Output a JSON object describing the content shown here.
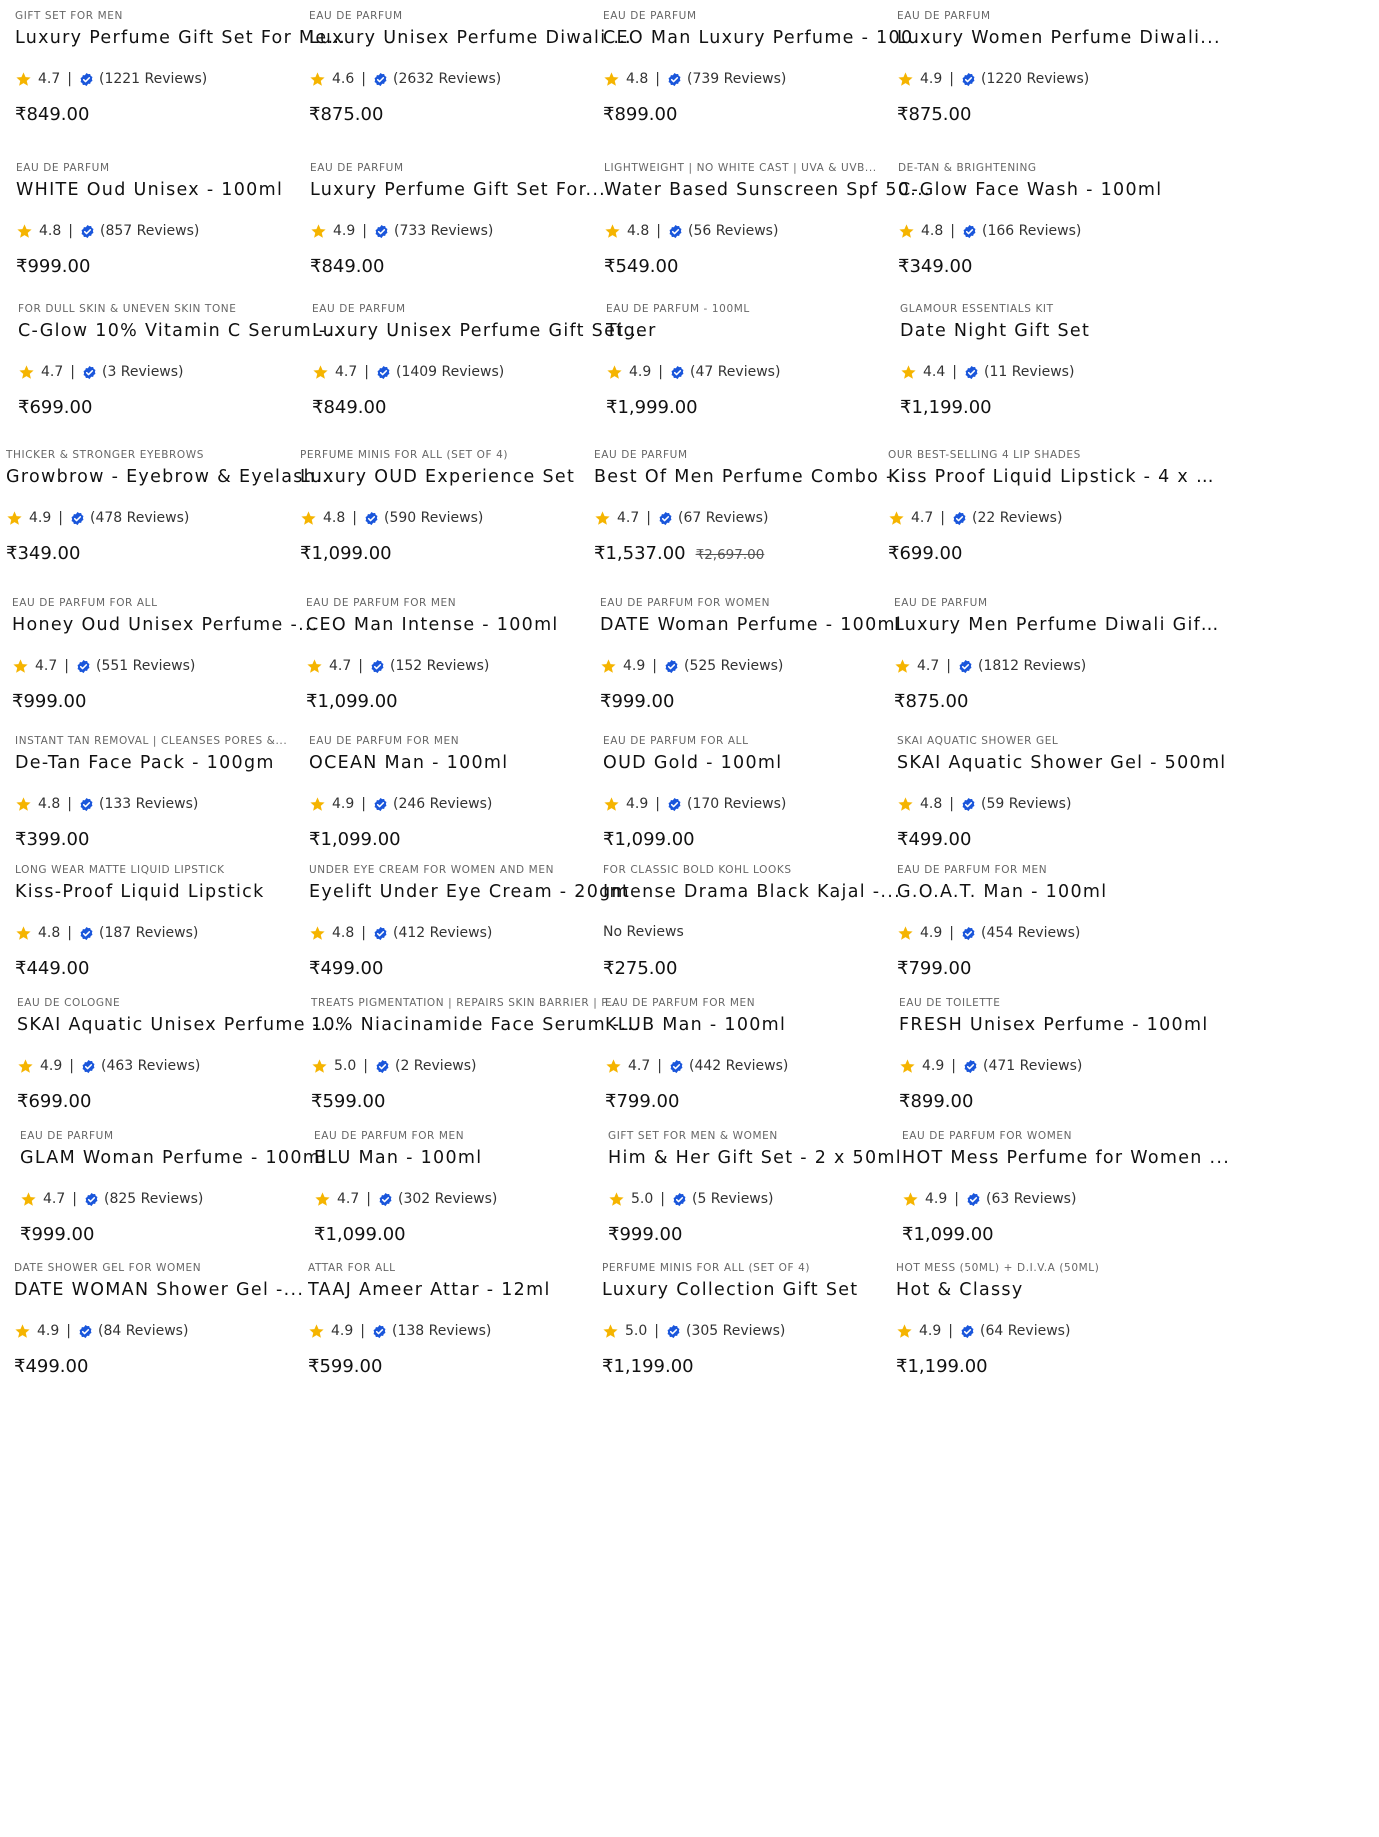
{
  "colors": {
    "star": "#f5b400",
    "verified_badge": "#1a56db",
    "text": "#111111",
    "muted": "#666666"
  },
  "icons": {
    "rating": "star-icon",
    "verified": "verified-badge-icon"
  },
  "products": [
    {
      "category": "Gift Set For Men",
      "title": "Luxury Perfume Gift Set For Me...",
      "rating": "4.7",
      "reviews": "(1221 Reviews)",
      "price": "₹849.00"
    },
    {
      "category": "Eau De Parfum",
      "title": "Luxury Unisex Perfume Diwali G...",
      "rating": "4.6",
      "reviews": "(2632 Reviews)",
      "price": "₹875.00"
    },
    {
      "category": "Eau De Parfum",
      "title": "CEO Man Luxury Perfume - 100ml",
      "rating": "4.8",
      "reviews": "(739 Reviews)",
      "price": "₹899.00"
    },
    {
      "category": "Eau De Parfum",
      "title": "Luxury Women Perfume Diwali...",
      "rating": "4.9",
      "reviews": "(1220 Reviews)",
      "price": "₹875.00"
    },
    {
      "category": "Eau De Parfum",
      "title": "WHITE Oud Unisex - 100ml",
      "rating": "4.8",
      "reviews": "(857 Reviews)",
      "price": "₹999.00"
    },
    {
      "category": "Eau De Parfum",
      "title": "Luxury Perfume Gift Set For...",
      "rating": "4.9",
      "reviews": "(733 Reviews)",
      "price": "₹849.00"
    },
    {
      "category": "Lightweight | No White Cast | UVA & UVB...",
      "title": "Water Based Sunscreen Spf 50...",
      "rating": "4.8",
      "reviews": "(56 Reviews)",
      "price": "₹549.00"
    },
    {
      "category": "De-Tan & Brightening",
      "title": "C-Glow Face Wash - 100ml",
      "rating": "4.8",
      "reviews": "(166 Reviews)",
      "price": "₹349.00"
    },
    {
      "category": "For Dull Skin & Uneven Skin Tone",
      "title": "C-Glow 10% Vitamin C Serum -...",
      "rating": "4.7",
      "reviews": "(3 Reviews)",
      "price": "₹699.00"
    },
    {
      "category": "Eau De Parfum",
      "title": "Luxury Unisex Perfume Gift Set ...",
      "rating": "4.7",
      "reviews": "(1409 Reviews)",
      "price": "₹849.00"
    },
    {
      "category": "Eau De Parfum - 100ml",
      "title": "Tiger",
      "rating": "4.9",
      "reviews": "(47 Reviews)",
      "price": "₹1,999.00"
    },
    {
      "category": "Glamour Essentials Kit",
      "title": "Date Night Gift Set",
      "rating": "4.4",
      "reviews": "(11 Reviews)",
      "price": "₹1,199.00"
    },
    {
      "category": "Thicker & Stronger Eyebrows",
      "title": "Growbrow - Eyebrow & Eyelash...",
      "rating": "4.9",
      "reviews": "(478 Reviews)",
      "price": "₹349.00"
    },
    {
      "category": "Perfume Minis For All (Set Of 4)",
      "title": "Luxury OUD Experience Set",
      "rating": "4.8",
      "reviews": "(590 Reviews)",
      "price": "₹1,099.00"
    },
    {
      "category": "Eau De Parfum",
      "title": "Best Of Men Perfume Combo -...",
      "rating": "4.7",
      "reviews": "(67 Reviews)",
      "price": "₹1,537.00",
      "original_price": "₹2,697.00"
    },
    {
      "category": "Our Best-Selling 4 Lip Shades",
      "title": "Kiss Proof Liquid Lipstick - 4 x 2...",
      "rating": "4.7",
      "reviews": "(22 Reviews)",
      "price": "₹699.00"
    },
    {
      "category": "Eau De Parfum For All",
      "title": "Honey Oud Unisex Perfume -...",
      "rating": "4.7",
      "reviews": "(551 Reviews)",
      "price": "₹999.00"
    },
    {
      "category": "Eau De Parfum For Men",
      "title": "CEO Man Intense - 100ml",
      "rating": "4.7",
      "reviews": "(152 Reviews)",
      "price": "₹1,099.00"
    },
    {
      "category": "Eau De Parfum For Women",
      "title": "DATE Woman Perfume - 100ml",
      "rating": "4.9",
      "reviews": "(525 Reviews)",
      "price": "₹999.00"
    },
    {
      "category": "Eau De Parfum",
      "title": "Luxury Men Perfume Diwali Gift...",
      "rating": "4.7",
      "reviews": "(1812 Reviews)",
      "price": "₹875.00"
    },
    {
      "category": "Instant Tan Removal | Cleanses Pores &...",
      "title": "De-Tan Face Pack - 100gm",
      "rating": "4.8",
      "reviews": "(133 Reviews)",
      "price": "₹399.00"
    },
    {
      "category": "Eau De Parfum For Men",
      "title": "OCEAN Man - 100ml",
      "rating": "4.9",
      "reviews": "(246 Reviews)",
      "price": "₹1,099.00"
    },
    {
      "category": "Eau De Parfum For All",
      "title": "OUD Gold - 100ml",
      "rating": "4.9",
      "reviews": "(170 Reviews)",
      "price": "₹1,099.00"
    },
    {
      "category": "SKAI Aquatic Shower Gel",
      "title": "SKAI Aquatic Shower Gel - 500ml",
      "rating": "4.8",
      "reviews": "(59 Reviews)",
      "price": "₹499.00"
    },
    {
      "category": "Long Wear Matte Liquid Lipstick",
      "title": "Kiss-Proof Liquid Lipstick",
      "rating": "4.8",
      "reviews": "(187 Reviews)",
      "price": "₹449.00"
    },
    {
      "category": "Under Eye Cream For Women And Men",
      "title": "Eyelift Under Eye Cream - 20gm",
      "rating": "4.8",
      "reviews": "(412 Reviews)",
      "price": "₹499.00"
    },
    {
      "category": "For Classic Bold Kohl Looks",
      "title": "Intense Drama Black Kajal -...",
      "rating": "",
      "reviews": "",
      "no_reviews": "No Reviews",
      "price": "₹275.00"
    },
    {
      "category": "Eau De Parfum For Men",
      "title": "G.O.A.T. Man - 100ml",
      "rating": "4.9",
      "reviews": "(454 Reviews)",
      "price": "₹799.00"
    },
    {
      "category": "Eau De Cologne",
      "title": "SKAI Aquatic Unisex Perfume -...",
      "rating": "4.9",
      "reviews": "(463 Reviews)",
      "price": "₹699.00"
    },
    {
      "category": "Treats Pigmentation | Repairs Skin Barrier | P...",
      "title": "10% Niacinamide Face Serum -...",
      "rating": "5.0",
      "reviews": "(2 Reviews)",
      "price": "₹599.00"
    },
    {
      "category": "Eau De Parfum For Men",
      "title": "KLUB Man - 100ml",
      "rating": "4.7",
      "reviews": "(442 Reviews)",
      "price": "₹799.00"
    },
    {
      "category": "Eau De Toilette",
      "title": "FRESH Unisex Perfume - 100ml",
      "rating": "4.9",
      "reviews": "(471 Reviews)",
      "price": "₹899.00"
    },
    {
      "category": "Eau De Parfum",
      "title": "GLAM Woman Perfume - 100ml",
      "rating": "4.7",
      "reviews": "(825 Reviews)",
      "price": "₹999.00"
    },
    {
      "category": "Eau De Parfum For Men",
      "title": "BLU Man - 100ml",
      "rating": "4.7",
      "reviews": "(302 Reviews)",
      "price": "₹1,099.00"
    },
    {
      "category": "Gift Set For Men & Women",
      "title": "Him & Her Gift Set - 2 x 50ml",
      "rating": "5.0",
      "reviews": "(5 Reviews)",
      "price": "₹999.00"
    },
    {
      "category": "Eau De Parfum For Women",
      "title": "HOT Mess Perfume for Women ...",
      "rating": "4.9",
      "reviews": "(63 Reviews)",
      "price": "₹1,099.00"
    },
    {
      "category": "Date Shower Gel For Women",
      "title": "DATE WOMAN Shower Gel -...",
      "rating": "4.9",
      "reviews": "(84 Reviews)",
      "price": "₹499.00"
    },
    {
      "category": "Attar For All",
      "title": "TAAJ Ameer Attar - 12ml",
      "rating": "4.9",
      "reviews": "(138 Reviews)",
      "price": "₹599.00"
    },
    {
      "category": "Perfume Minis For All (Set Of 4)",
      "title": "Luxury Collection Gift Set",
      "rating": "5.0",
      "reviews": "(305 Reviews)",
      "price": "₹1,199.00"
    },
    {
      "category": "Hot Mess (50ml) + D.I.V.A (50ml)",
      "title": "Hot & Classy",
      "rating": "4.9",
      "reviews": "(64 Reviews)",
      "price": "₹1,199.00"
    }
  ]
}
